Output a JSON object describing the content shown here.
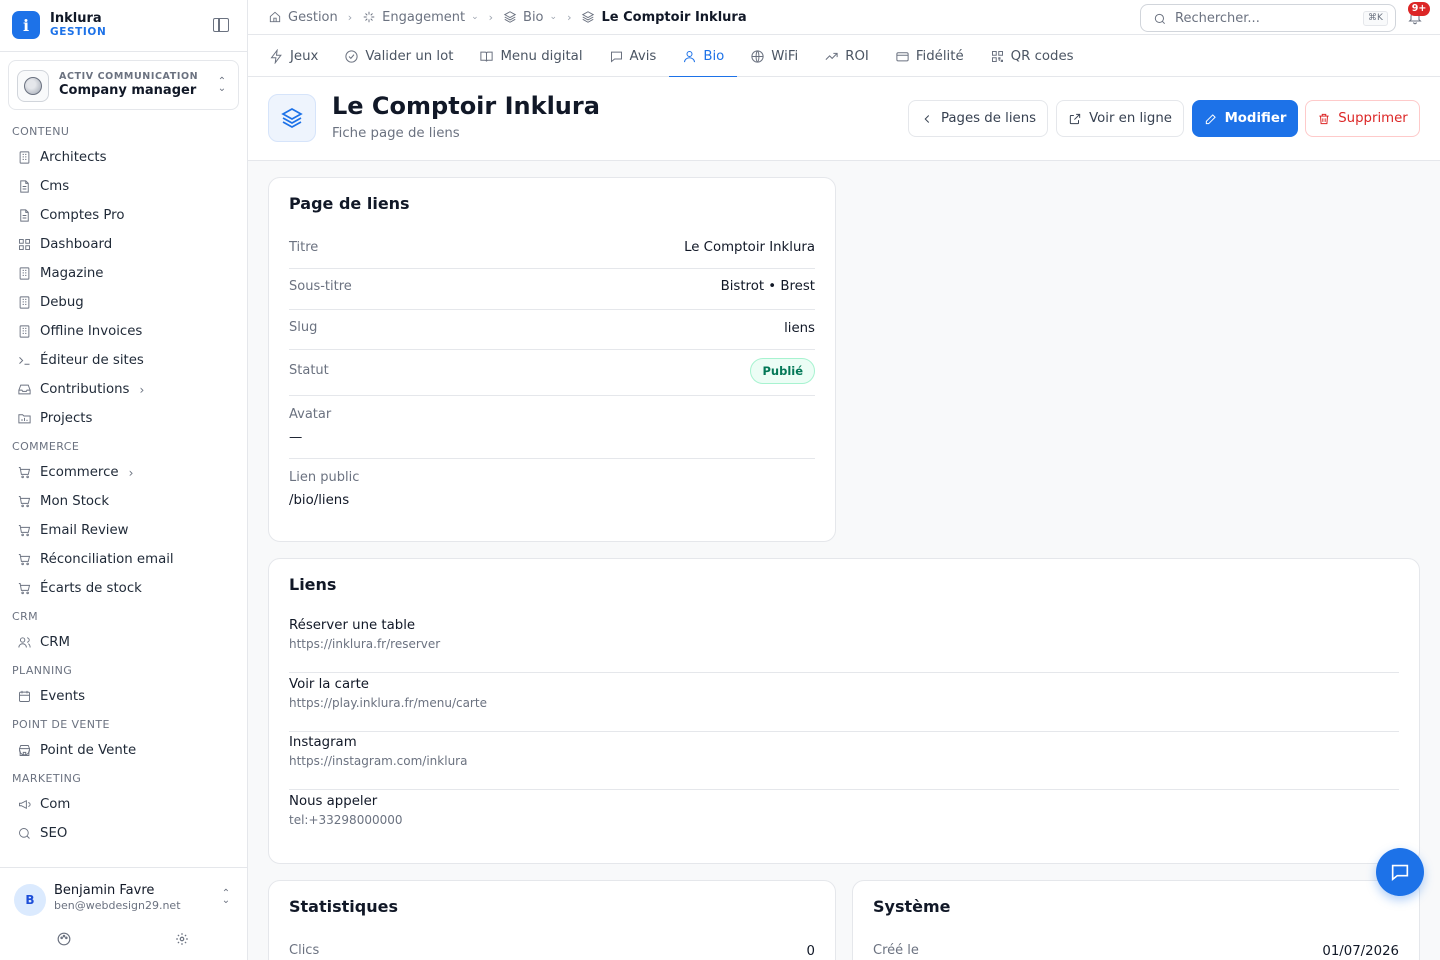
{
  "brand": {
    "name": "Inklura",
    "sub": "GESTION",
    "logo_glyph": "i"
  },
  "company": {
    "org": "ACTIV COMMUNICATION",
    "role": "Company manager"
  },
  "sidebar": {
    "sections": [
      {
        "title": "CONTENU",
        "items": [
          {
            "label": "Architects",
            "icon": "building-icon"
          },
          {
            "label": "Cms",
            "icon": "file-icon"
          },
          {
            "label": "Comptes Pro",
            "icon": "file-icon"
          },
          {
            "label": "Dashboard",
            "icon": "grid-icon"
          },
          {
            "label": "Magazine",
            "icon": "building-icon"
          },
          {
            "label": "Debug",
            "icon": "building-icon"
          },
          {
            "label": "Offline Invoices",
            "icon": "building-icon"
          },
          {
            "label": "Éditeur de sites",
            "icon": "terminal-icon"
          },
          {
            "label": "Contributions",
            "icon": "inbox-icon",
            "chevron": "›"
          },
          {
            "label": "Projects",
            "icon": "folder-icon"
          }
        ]
      },
      {
        "title": "COMMERCE",
        "items": [
          {
            "label": "Ecommerce",
            "icon": "cart-icon",
            "chevron": "›"
          },
          {
            "label": "Mon Stock",
            "icon": "cart-icon"
          },
          {
            "label": "Email Review",
            "icon": "cart-icon"
          },
          {
            "label": "Réconciliation email",
            "icon": "cart-icon"
          },
          {
            "label": "Écarts de stock",
            "icon": "cart-icon"
          }
        ]
      },
      {
        "title": "CRM",
        "items": [
          {
            "label": "CRM",
            "icon": "users-icon"
          }
        ]
      },
      {
        "title": "PLANNING",
        "items": [
          {
            "label": "Events",
            "icon": "calendar-icon"
          }
        ]
      },
      {
        "title": "POINT DE VENTE",
        "items": [
          {
            "label": "Point de Vente",
            "icon": "store-icon"
          }
        ]
      },
      {
        "title": "MARKETING",
        "items": [
          {
            "label": "Com",
            "icon": "megaphone-icon"
          },
          {
            "label": "SEO",
            "icon": "search-icon"
          }
        ]
      }
    ]
  },
  "user": {
    "initial": "B",
    "name": "Benjamin Favre",
    "email": "ben@webdesign29.net"
  },
  "breadcrumb": {
    "items": [
      {
        "label": "Gestion",
        "icon": "home-icon",
        "dropdown": false
      },
      {
        "label": "Engagement",
        "icon": "sparkles-icon",
        "dropdown": true
      },
      {
        "label": "Bio",
        "icon": "layers-icon",
        "dropdown": true
      },
      {
        "label": "Le Comptoir Inklura",
        "icon": "layers-icon",
        "dropdown": false,
        "current": true
      }
    ]
  },
  "search": {
    "placeholder": "Rechercher...",
    "shortcut": "⌘K"
  },
  "notifications": {
    "badge": "9+"
  },
  "tabs": [
    {
      "label": "Jeux",
      "icon": "bolt-icon"
    },
    {
      "label": "Valider un lot",
      "icon": "check-circle-icon"
    },
    {
      "label": "Menu digital",
      "icon": "book-icon"
    },
    {
      "label": "Avis",
      "icon": "message-icon"
    },
    {
      "label": "Bio",
      "icon": "user-icon",
      "active": true
    },
    {
      "label": "WiFi",
      "icon": "globe-icon"
    },
    {
      "label": "ROI",
      "icon": "trend-icon"
    },
    {
      "label": "Fidélité",
      "icon": "card-icon"
    },
    {
      "label": "QR codes",
      "icon": "qr-icon"
    }
  ],
  "header": {
    "title": "Le Comptoir Inklura",
    "subtitle": "Fiche page de liens",
    "actions": {
      "back": "Pages de liens",
      "view": "Voir en ligne",
      "edit": "Modifier",
      "delete": "Supprimer"
    }
  },
  "info_card": {
    "title": "Page de liens",
    "rows": {
      "titre": {
        "label": "Titre",
        "value": "Le Comptoir Inklura"
      },
      "soustitre": {
        "label": "Sous-titre",
        "value": "Bistrot • Brest"
      },
      "slug": {
        "label": "Slug",
        "value": "liens"
      },
      "statut": {
        "label": "Statut",
        "value": "Publié"
      },
      "avatar": {
        "label": "Avatar",
        "value": "—"
      },
      "lien": {
        "label": "Lien public",
        "value": "/bio/liens"
      }
    }
  },
  "links_card": {
    "title": "Liens",
    "items": [
      {
        "title": "Réserver une table",
        "url": "https://inklura.fr/reserver"
      },
      {
        "title": "Voir la carte",
        "url": "https://play.inklura.fr/menu/carte"
      },
      {
        "title": "Instagram",
        "url": "https://instagram.com/inklura"
      },
      {
        "title": "Nous appeler",
        "url": "tel:+33298000000"
      }
    ]
  },
  "stats_card": {
    "title": "Statistiques",
    "clicks_label": "Clics",
    "clicks_value": "0"
  },
  "system_card": {
    "title": "Système",
    "created_label": "Créé le",
    "created_value": "01/07/2026"
  },
  "colors": {
    "accent": "#1d72e8",
    "danger": "#dc2626",
    "success": "#047857"
  }
}
